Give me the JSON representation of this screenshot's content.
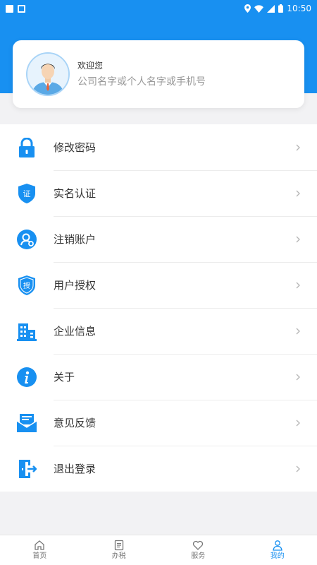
{
  "status_bar": {
    "time": "10:50"
  },
  "profile": {
    "welcome": "欢迎您",
    "account_name": "公司名字或个人名字或手机号"
  },
  "menu": [
    {
      "label": "修改密码",
      "icon": "lock-icon"
    },
    {
      "label": "实名认证",
      "icon": "id-verify-shield-icon"
    },
    {
      "label": "注销账户",
      "icon": "user-cancel-icon"
    },
    {
      "label": "用户授权",
      "icon": "authorize-shield-icon"
    },
    {
      "label": "企业信息",
      "icon": "building-icon"
    },
    {
      "label": "关于",
      "icon": "info-icon"
    },
    {
      "label": "意见反馈",
      "icon": "feedback-mail-icon"
    },
    {
      "label": "退出登录",
      "icon": "logout-door-icon"
    }
  ],
  "tabs": [
    {
      "label": "首页",
      "icon": "home-icon",
      "active": false
    },
    {
      "label": "办税",
      "icon": "document-list-icon",
      "active": false
    },
    {
      "label": "服务",
      "icon": "heart-icon",
      "active": false
    },
    {
      "label": "我的",
      "icon": "person-icon",
      "active": true
    }
  ],
  "colors": {
    "primary": "#1890f1",
    "background": "#f2f2f4"
  },
  "icon_glyphs": {
    "id_verify": "证",
    "authorize": "授"
  }
}
